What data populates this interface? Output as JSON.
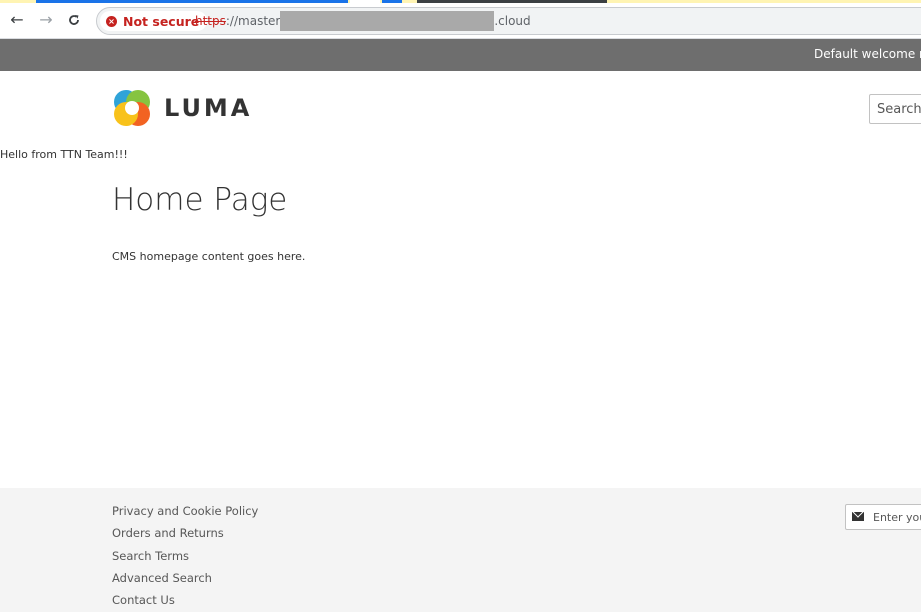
{
  "browser": {
    "security_label": "Not secure",
    "url_scheme": "https",
    "url_after_scheme": "://master",
    "url_tail": ".cloud",
    "icons": {
      "back": "arrow-left-icon",
      "forward": "arrow-right-icon",
      "reload": "reload-icon",
      "security": "error-circle-icon"
    },
    "colors": {
      "security": "#c5221f",
      "tab_strip": "#fff4b3"
    }
  },
  "header": {
    "welcome_text": "Default welcome ms",
    "logo_text": "LUMA",
    "search_placeholder": "Search",
    "background_color": "#6e6e6e"
  },
  "main": {
    "greeting": "Hello from TTN Team!!!",
    "page_title": "Home Page",
    "content": "CMS homepage content goes here."
  },
  "footer": {
    "links": [
      "Privacy and Cookie Policy",
      "Orders and Returns",
      "Search Terms",
      "Advanced Search",
      "Contact Us"
    ],
    "newsletter_placeholder": "Enter you",
    "newsletter_icon": "envelope-icon"
  }
}
